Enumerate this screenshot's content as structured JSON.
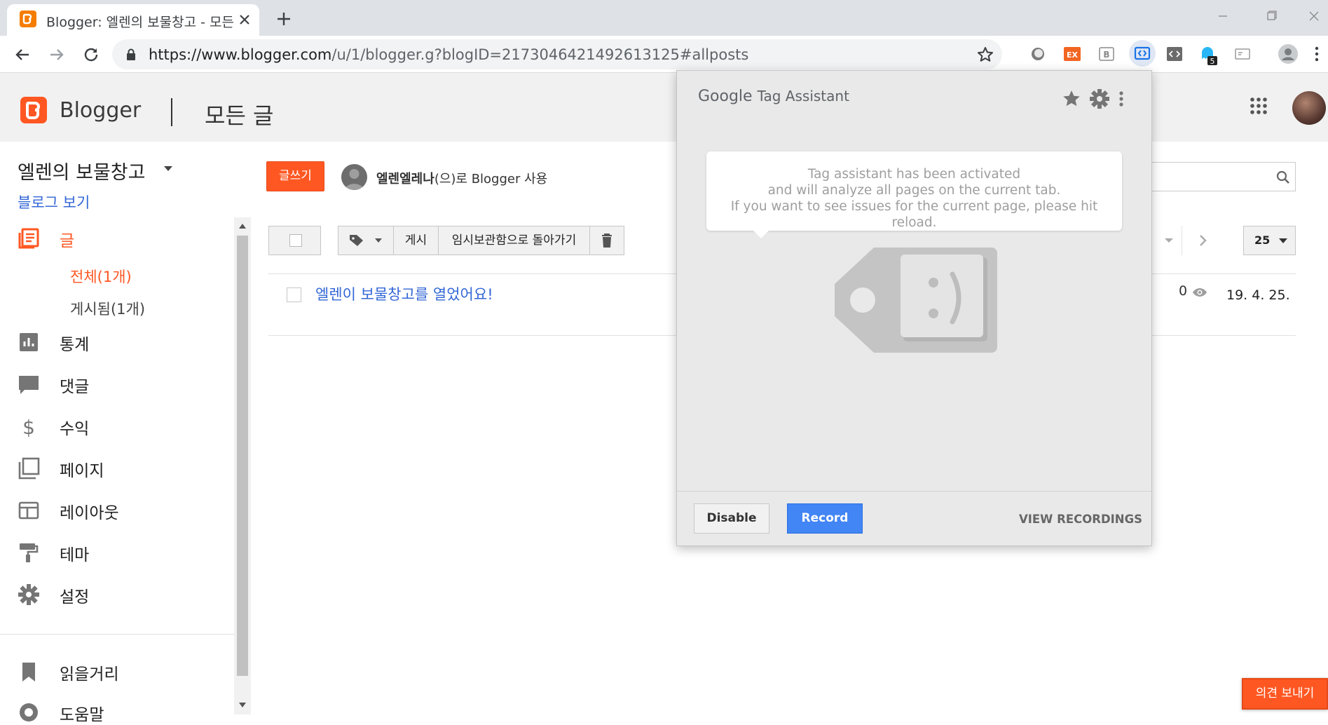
{
  "browser": {
    "tab_title": "Blogger: 엘렌의 보물창고 - 모든",
    "url_host": "https://www.blogger.com",
    "url_path": "/u/1/blogger.g?blogID=217304642149261312​5#allposts",
    "extension_badge": "5"
  },
  "header": {
    "brand": "Blogger",
    "page_title": "모든 글"
  },
  "sidebar": {
    "blog_name": "엘렌의 보물창고",
    "view_blog": "블로그 보기",
    "items": [
      {
        "label": "글",
        "icon": "posts-icon"
      },
      {
        "label": "통계",
        "icon": "stats-icon"
      },
      {
        "label": "댓글",
        "icon": "comment-icon"
      },
      {
        "label": "수익",
        "icon": "dollar-icon"
      },
      {
        "label": "페이지",
        "icon": "pages-icon"
      },
      {
        "label": "레이아웃",
        "icon": "layout-icon"
      },
      {
        "label": "테마",
        "icon": "paint-roller-icon"
      },
      {
        "label": "설정",
        "icon": "gear-icon"
      },
      {
        "label": "읽을거리",
        "icon": "bookmark-icon"
      },
      {
        "label": "도움말",
        "icon": "help-icon"
      }
    ],
    "sub_items": {
      "all": "전체(1개)",
      "published": "게시됨(1개)"
    }
  },
  "main": {
    "new_post": "글쓰기",
    "user_name": "엘렌엘레나",
    "user_suffix": "(으)로 Blogger 사용",
    "toolbar": {
      "publish": "게시",
      "revert": "임시보관함으로 돌아가기"
    },
    "per_page": "25",
    "posts": [
      {
        "title": "엘렌이 보물창고를 열었어요!",
        "views": "0",
        "date": "19. 4. 25."
      }
    ],
    "feedback": "의견 보내기"
  },
  "tag_assistant": {
    "logo_google": "Google",
    "logo_product": "Tag Assistant",
    "message_line1": "Tag assistant has been activated",
    "message_line2": "and will analyze all pages on the current tab.",
    "message_line3": "If you want to see issues for the current page, please hit reload.",
    "disable": "Disable",
    "record": "Record",
    "view_recordings": "VIEW RECORDINGS"
  },
  "colors": {
    "blogger_orange": "#ff5722",
    "link_blue": "#3367d6",
    "record_blue": "#4285f4"
  }
}
